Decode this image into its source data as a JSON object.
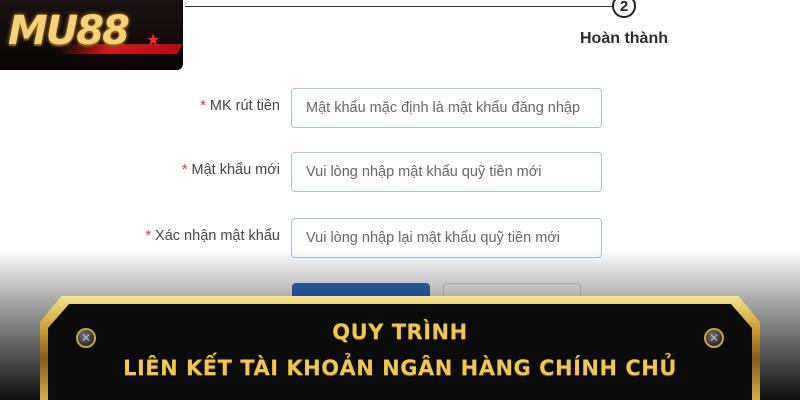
{
  "steps": {
    "current_number": "2",
    "current_label": "Hoàn thành"
  },
  "logo": {
    "text": "MU88"
  },
  "form": {
    "required_mark": "*",
    "fields": [
      {
        "label": "MK rút tiền",
        "placeholder": "Mật khẩu mặc định là mật khẩu đăng nhập"
      },
      {
        "label": "Mật khẩu mới",
        "placeholder": "Vui lòng nhập mật khẩu quỹ tiền mới"
      },
      {
        "label": "Xác nhận mật khẩu",
        "placeholder": "Vui lòng nhập lại mật khẩu quỹ tiền mới"
      }
    ]
  },
  "banner": {
    "line1": "QUY TRÌNH",
    "line2": "LIÊN KẾT TÀI KHOẢN NGÂN HÀNG CHÍNH CHỦ"
  },
  "colors": {
    "primary_button": "#2d6fc7",
    "input_border": "#9ec2e6",
    "required": "#e3342f",
    "banner_text": "#f2c84b"
  }
}
